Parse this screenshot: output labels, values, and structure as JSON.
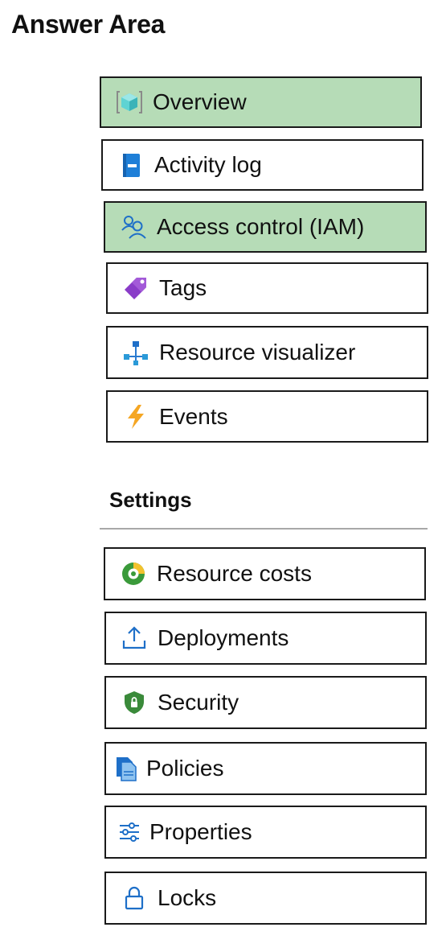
{
  "title": "Answer Area",
  "items": [
    {
      "label": "Overview",
      "icon": "overview-icon",
      "selected": true
    },
    {
      "label": "Activity log",
      "icon": "activity-log-icon",
      "selected": false
    },
    {
      "label": "Access control (IAM)",
      "icon": "access-control-icon",
      "selected": true
    },
    {
      "label": "Tags",
      "icon": "tag-icon",
      "selected": false
    },
    {
      "label": "Resource visualizer",
      "icon": "resource-visualizer-icon",
      "selected": false
    },
    {
      "label": "Events",
      "icon": "lightning-icon",
      "selected": false
    }
  ],
  "settings": {
    "heading": "Settings",
    "items": [
      {
        "label": "Resource costs",
        "icon": "resource-costs-icon"
      },
      {
        "label": "Deployments",
        "icon": "deployments-icon"
      },
      {
        "label": "Security",
        "icon": "shield-icon"
      },
      {
        "label": "Policies",
        "icon": "policies-icon"
      },
      {
        "label": "Properties",
        "icon": "properties-icon"
      },
      {
        "label": "Locks",
        "icon": "lock-icon"
      }
    ]
  },
  "colors": {
    "selected_background": "#b6dcb7",
    "border": "#1a1a1a",
    "divider": "#a8a8a8"
  }
}
